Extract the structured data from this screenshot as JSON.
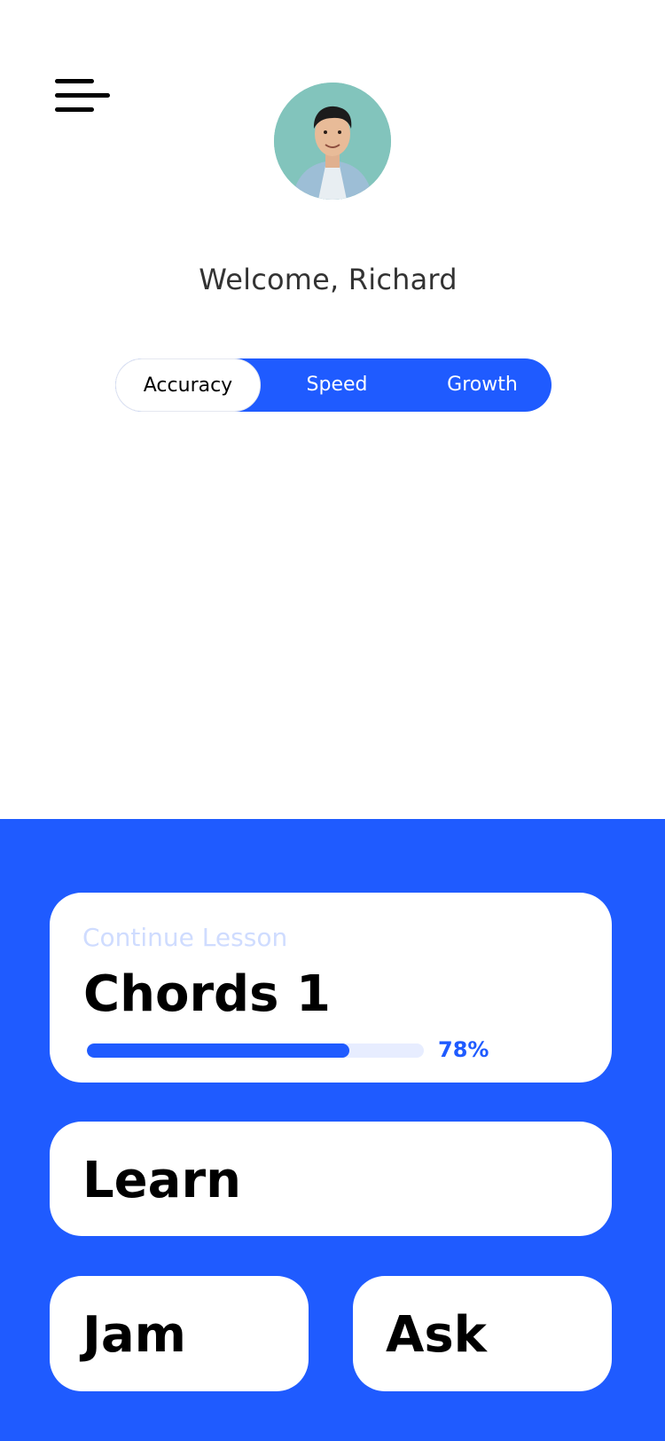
{
  "header": {
    "menu_icon": "hamburger-menu-icon",
    "avatar_alt": "user-avatar",
    "welcome_text": "Welcome, Richard"
  },
  "tabs": [
    {
      "label": "Accuracy",
      "selected": true
    },
    {
      "label": "Speed",
      "selected": false
    },
    {
      "label": "Growth",
      "selected": false
    }
  ],
  "continue_lesson": {
    "label": "Continue Lesson",
    "title": "Chords 1",
    "progress": 0.78,
    "progress_text": "78%"
  },
  "actions": {
    "learn": "Learn",
    "jam": "Jam",
    "ask": "Ask"
  },
  "colors": {
    "accent": "#1f5bff",
    "background": "#ffffff",
    "card": "#ffffff"
  }
}
